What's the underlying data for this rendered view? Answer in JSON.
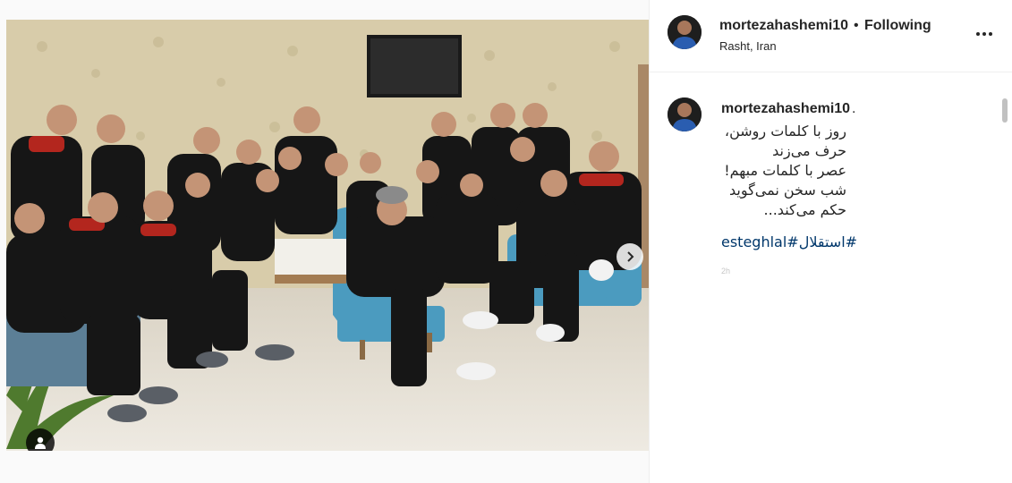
{
  "post": {
    "username": "mortezahashemi10",
    "separator": "•",
    "follow_status": "Following",
    "location": "Rasht, Iran",
    "more_icon": "more-horizontal-icon"
  },
  "caption": {
    "username": "mortezahashemi10",
    "trailing": ".",
    "lines": [
      "روز با کلمات روشن،",
      "حرف می‌زند",
      "عصر با کلمات مبهم!",
      "شب سخن نمی‌گوید",
      "حکم می‌کند..."
    ],
    "hashtags": "#استقلال#esteghlal",
    "faded_text": "2h"
  },
  "media": {
    "carousel_pages": 2,
    "active_page": 1,
    "next_icon": "chevron-right-icon",
    "tag_icon": "user-tag-icon"
  },
  "colors": {
    "link": "#00376b",
    "accent": "#3897f0",
    "text": "#262626",
    "border": "#efefef"
  }
}
